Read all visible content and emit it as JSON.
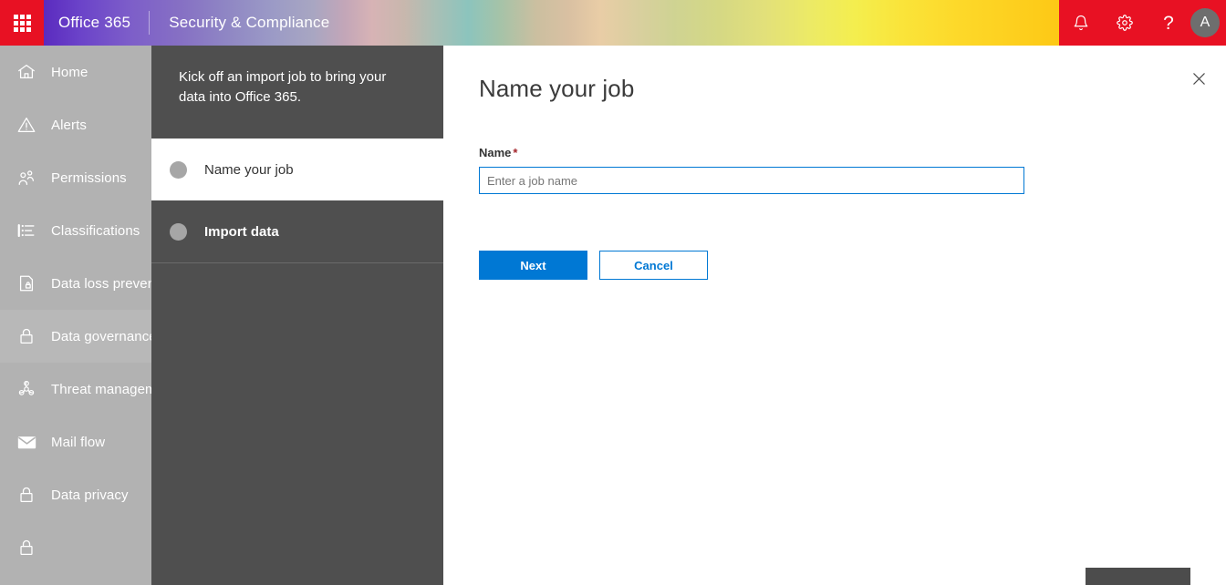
{
  "suite": {
    "waffle_icon": "app-launcher-waffle-icon",
    "brand": "Office 365",
    "app_name": "Security & Compliance",
    "icons": {
      "notifications": "bell-icon",
      "settings": "gear-icon",
      "help": "?",
      "help_icon_name": "question-mark-icon"
    },
    "avatar_initial": "A",
    "colors": {
      "waffle_bg": "#e81123",
      "right_bg": "#e81123",
      "text": "#ffffff"
    }
  },
  "sidebar": {
    "items": [
      {
        "label": "Home",
        "icon": "home-icon"
      },
      {
        "label": "Alerts",
        "icon": "alert-triangle-icon"
      },
      {
        "label": "Permissions",
        "icon": "people-icon"
      },
      {
        "label": "Classifications",
        "icon": "list-icon"
      },
      {
        "label": "Data loss prevention",
        "icon": "document-lock-icon"
      },
      {
        "label": "Data governance",
        "icon": "padlock-icon"
      },
      {
        "label": "Threat management",
        "icon": "biohazard-icon"
      },
      {
        "label": "Mail flow",
        "icon": "envelope-icon"
      },
      {
        "label": "Data privacy",
        "icon": "padlock-icon"
      }
    ],
    "bg_color": "#b2b2b2"
  },
  "wizard": {
    "intro": "Kick off an import job to bring your data into Office 365.",
    "steps": [
      {
        "label": "Name your job",
        "state": "active"
      },
      {
        "label": "Import data",
        "state": "inactive"
      }
    ],
    "bg_color": "#4f4f4f"
  },
  "main": {
    "title": "Name your job",
    "close_icon": "close-x-icon",
    "form": {
      "name_label": "Name",
      "required_marker": "*",
      "name_value": "",
      "name_placeholder": "Enter a job name"
    },
    "buttons": {
      "primary": "Next",
      "secondary": "Cancel",
      "primary_color": "#0078d4",
      "secondary_text_color": "#0078d4"
    }
  }
}
